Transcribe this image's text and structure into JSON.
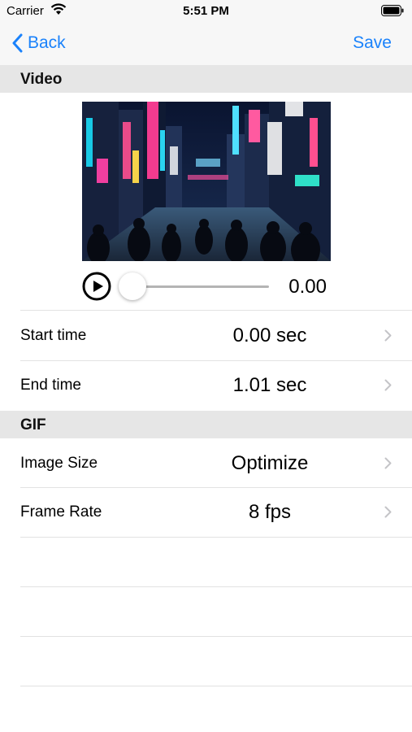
{
  "status_bar": {
    "carrier": "Carrier",
    "time": "5:51 PM"
  },
  "nav": {
    "back_label": "Back",
    "save_label": "Save"
  },
  "sections": {
    "video": "Video",
    "gif": "GIF"
  },
  "player": {
    "time_readout": "0.00",
    "progress": 0
  },
  "video_rows": [
    {
      "label": "Start time",
      "value": "0.00 sec"
    },
    {
      "label": "End time",
      "value": "1.01 sec"
    }
  ],
  "gif_rows": [
    {
      "label": "Image Size",
      "value": "Optimize"
    },
    {
      "label": "Frame Rate",
      "value": "8 fps"
    }
  ],
  "colors": {
    "accent": "#1a82fb",
    "header_bg": "#e6e6e6",
    "separator": "#e2e2e2"
  }
}
